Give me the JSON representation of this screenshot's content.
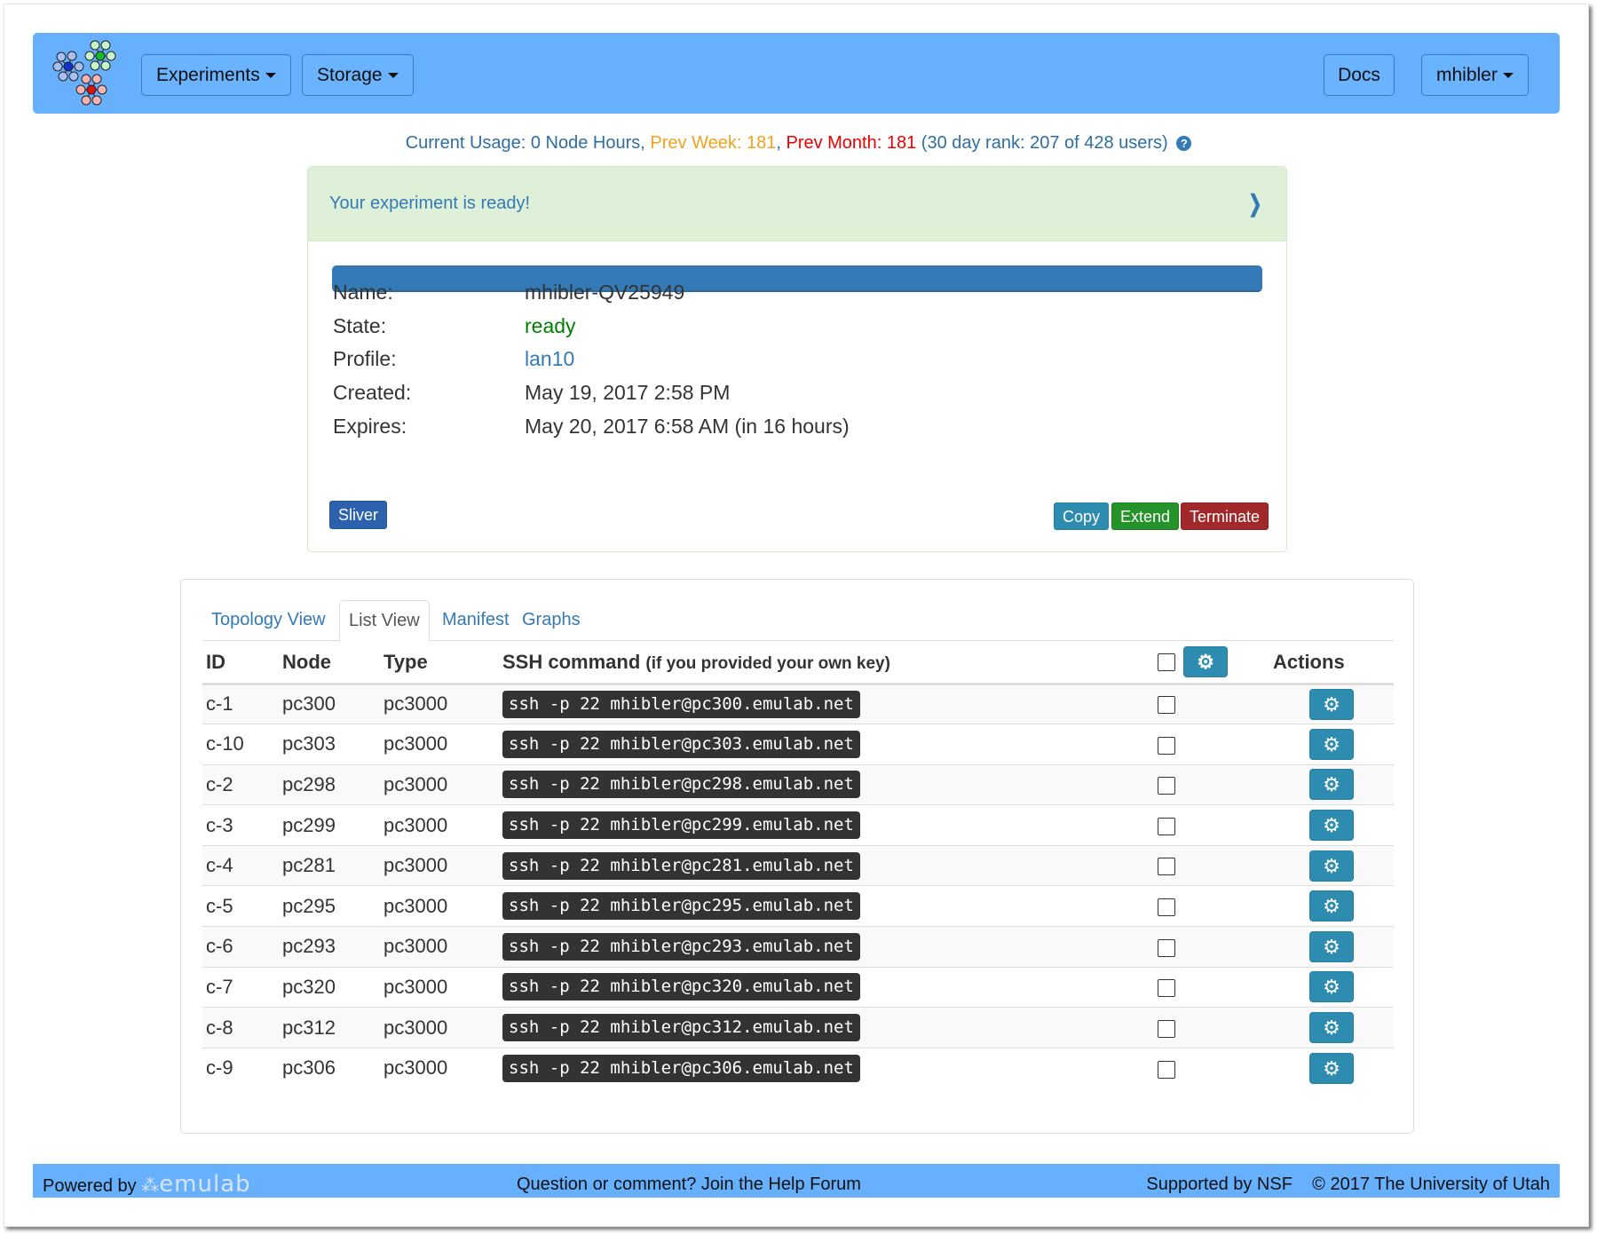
{
  "navbar": {
    "logo": "emulab-network-logo",
    "experiments_label": "Experiments",
    "storage_label": "Storage",
    "docs_label": "Docs",
    "user_label": "mhibler",
    "background_color": "#66b0fd"
  },
  "usage": {
    "current_prefix": "Current Usage: 0 Node Hours,",
    "prev_week": "Prev Week: 181",
    "prev_month": "Prev Month: 181",
    "rank": "(30 day rank: 207 of 428 users)",
    "help_icon": "question-circle-icon",
    "colors": {
      "current": "#2f6ea3",
      "week": "#f4a21a",
      "month": "#ee0000"
    }
  },
  "status": {
    "message": "Your experiment is ready!",
    "progress_percent": 100,
    "fields": [
      {
        "label": "Name:",
        "value": "mhibler-QV25949"
      },
      {
        "label": "State:",
        "value": "ready"
      },
      {
        "label": "Profile:",
        "value": "lan10"
      },
      {
        "label": "Created:",
        "value": "May 19, 2017 2:58 PM"
      },
      {
        "label": "Expires:",
        "value": "May 20, 2017 6:58 AM (in 16 hours)"
      }
    ],
    "buttons": {
      "sliver": "Sliver",
      "copy": "Copy",
      "extend": "Extend",
      "terminate": "Terminate"
    }
  },
  "tabs": [
    {
      "label": "Topology View",
      "active": false
    },
    {
      "label": "List View",
      "active": true
    },
    {
      "label": "Manifest",
      "active": false
    },
    {
      "label": "Graphs",
      "active": false
    }
  ],
  "table": {
    "headers": {
      "id": "ID",
      "node": "Node",
      "type": "Type",
      "ssh": "SSH command",
      "ssh_note": "(if you provided your own key)",
      "actions": "Actions"
    },
    "rows": [
      {
        "id": "c-1",
        "node": "pc300",
        "type": "pc3000",
        "ssh": "ssh -p 22 mhibler@pc300.emulab.net"
      },
      {
        "id": "c-10",
        "node": "pc303",
        "type": "pc3000",
        "ssh": "ssh -p 22 mhibler@pc303.emulab.net"
      },
      {
        "id": "c-2",
        "node": "pc298",
        "type": "pc3000",
        "ssh": "ssh -p 22 mhibler@pc298.emulab.net"
      },
      {
        "id": "c-3",
        "node": "pc299",
        "type": "pc3000",
        "ssh": "ssh -p 22 mhibler@pc299.emulab.net"
      },
      {
        "id": "c-4",
        "node": "pc281",
        "type": "pc3000",
        "ssh": "ssh -p 22 mhibler@pc281.emulab.net"
      },
      {
        "id": "c-5",
        "node": "pc295",
        "type": "pc3000",
        "ssh": "ssh -p 22 mhibler@pc295.emulab.net"
      },
      {
        "id": "c-6",
        "node": "pc293",
        "type": "pc3000",
        "ssh": "ssh -p 22 mhibler@pc293.emulab.net"
      },
      {
        "id": "c-7",
        "node": "pc320",
        "type": "pc3000",
        "ssh": "ssh -p 22 mhibler@pc320.emulab.net"
      },
      {
        "id": "c-8",
        "node": "pc312",
        "type": "pc3000",
        "ssh": "ssh -p 22 mhibler@pc312.emulab.net"
      },
      {
        "id": "c-9",
        "node": "pc306",
        "type": "pc3000",
        "ssh": "ssh -p 22 mhibler@pc306.emulab.net"
      }
    ]
  },
  "footer": {
    "powered_by": "Powered by",
    "brand": "emulab",
    "help": "Question or comment? Join the Help Forum",
    "supported": "Supported by NSF",
    "copyright": "© 2017 The University of Utah"
  }
}
